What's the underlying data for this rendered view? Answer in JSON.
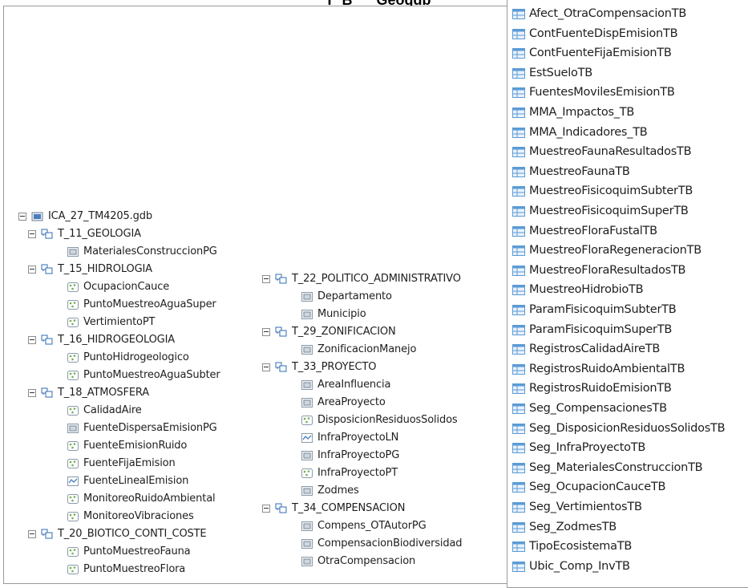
{
  "page": {
    "title": "_T_B___Geogdb"
  },
  "tree": {
    "gdb": {
      "label": "ICA_27_TM4205.gdb"
    },
    "datasets": [
      {
        "label": "T_11_GEOLOGIA",
        "items": [
          {
            "label": "MaterialesConstruccionPG",
            "icon": "polygon-fc-icon"
          }
        ]
      },
      {
        "label": "T_15_HIDROLOGIA",
        "items": [
          {
            "label": "OcupacionCauce",
            "icon": "point-fc-icon"
          },
          {
            "label": "PuntoMuestreoAguaSuper",
            "icon": "point-fc-icon"
          },
          {
            "label": "VertimientoPT",
            "icon": "point-fc-icon"
          }
        ]
      },
      {
        "label": "T_16_HIDROGEOLOGIA",
        "items": [
          {
            "label": "PuntoHidrogeologico",
            "icon": "point-fc-icon"
          },
          {
            "label": "PuntoMuestreoAguaSubter",
            "icon": "point-fc-icon"
          }
        ]
      },
      {
        "label": "T_18_ATMOSFERA",
        "items": [
          {
            "label": "CalidadAire",
            "icon": "point-fc-icon"
          },
          {
            "label": "FuenteDispersaEmisionPG",
            "icon": "polygon-fc-icon"
          },
          {
            "label": "FuenteEmisionRuido",
            "icon": "point-fc-icon"
          },
          {
            "label": "FuenteFijaEmision",
            "icon": "point-fc-icon"
          },
          {
            "label": "FuenteLinealEmision",
            "icon": "line-fc-icon"
          },
          {
            "label": "MonitoreoRuidoAmbiental",
            "icon": "point-fc-icon"
          },
          {
            "label": "MonitoreoVibraciones",
            "icon": "point-fc-icon"
          }
        ]
      },
      {
        "label": "T_20_BIOTICO_CONTI_COSTE",
        "items": [
          {
            "label": "PuntoMuestreoFauna",
            "icon": "point-fc-icon"
          },
          {
            "label": "PuntoMuestreoFlora",
            "icon": "point-fc-icon"
          }
        ]
      },
      {
        "label": "T_22_POLITICO_ADMINISTRATIVO",
        "items": [
          {
            "label": "Departamento",
            "icon": "polygon-fc-icon"
          },
          {
            "label": "Municipio",
            "icon": "polygon-fc-icon"
          }
        ]
      },
      {
        "label": "T_29_ZONIFICACION",
        "items": [
          {
            "label": "ZonificacionManejo",
            "icon": "polygon-fc-icon"
          }
        ]
      },
      {
        "label": "T_33_PROYECTO",
        "items": [
          {
            "label": "AreaInfluencia",
            "icon": "polygon-fc-icon"
          },
          {
            "label": "AreaProyecto",
            "icon": "polygon-fc-icon"
          },
          {
            "label": "DisposicionResiduosSolidos",
            "icon": "point-fc-icon"
          },
          {
            "label": "InfraProyectoLN",
            "icon": "line-fc-icon"
          },
          {
            "label": "InfraProyectoPG",
            "icon": "polygon-fc-icon"
          },
          {
            "label": "InfraProyectoPT",
            "icon": "point-fc-icon"
          },
          {
            "label": "Zodmes",
            "icon": "polygon-fc-icon"
          }
        ]
      },
      {
        "label": "T_34_COMPENSACION",
        "items": [
          {
            "label": "Compens_OTAutorPG",
            "icon": "polygon-fc-icon"
          },
          {
            "label": "CompensacionBiodiversidad",
            "icon": "polygon-fc-icon"
          },
          {
            "label": "OtraCompensacion",
            "icon": "polygon-fc-icon"
          }
        ]
      }
    ],
    "tables": [
      "Afect_OtraCompensacionTB",
      "ContFuenteDispEmisionTB",
      "ContFuenteFijaEmisionTB",
      "EstSueloTB",
      "FuentesMovilesEmisionTB",
      "MMA_Impactos_TB",
      "MMA_Indicadores_TB",
      "MuestreoFaunaResultadosTB",
      "MuestreoFaunaTB",
      "MuestreoFisicoquimSubterTB",
      "MuestreoFisicoquimSuperTB",
      "MuestreoFloraFustalTB",
      "MuestreoFloraRegeneracionTB",
      "MuestreoFloraResultadosTB",
      "MuestreoHidrobioTB",
      "ParamFisicoquimSubterTB",
      "ParamFisicoquimSuperTB",
      "RegistrosCalidadAireTB",
      "RegistrosRuidoAmbientalTB",
      "RegistrosRuidoEmisionTB",
      "Seg_CompensacionesTB",
      "Seg_DisposicionResiduosSolidosTB",
      "Seg_InfraProyectoTB",
      "Seg_MaterialesConstruccionTB",
      "Seg_OcupacionCauceTB",
      "Seg_VertimientosTB",
      "Seg_ZodmesTB",
      "TipoEcosistemaTB",
      "Ubic_Comp_InvTB"
    ]
  },
  "colors": {
    "expander_border": "#8c8c8c",
    "dataset_icon": "#2f6cb3",
    "table_icon": "#5b9bd5",
    "point_icon": "#6fae52",
    "polygon_icon": "#7a8a99"
  }
}
